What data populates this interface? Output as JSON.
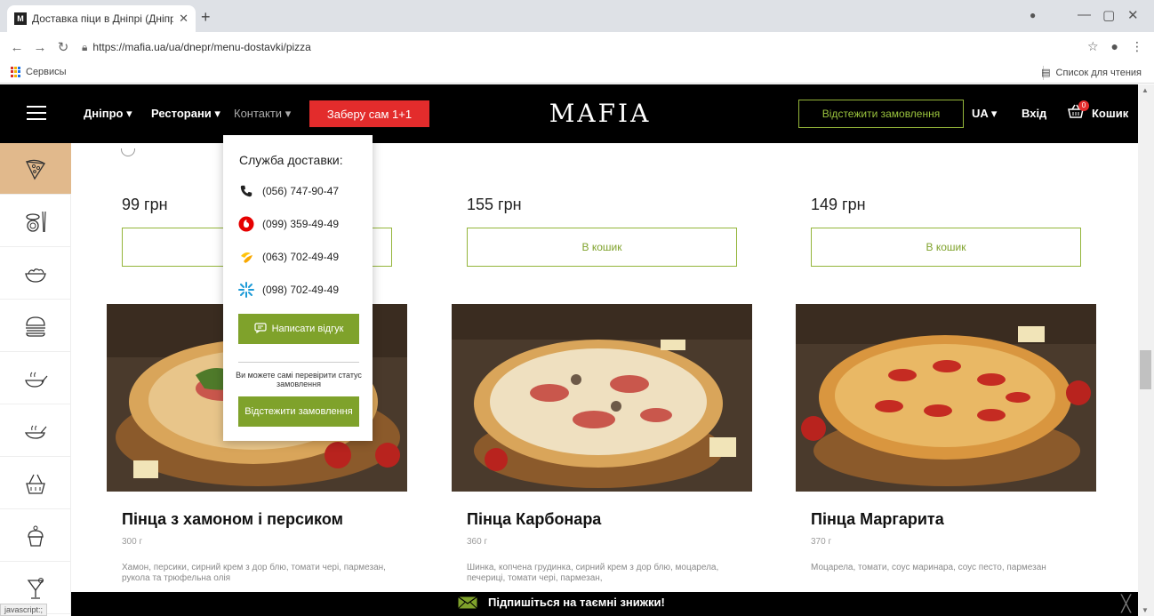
{
  "browser": {
    "tab_title": "Доставка піци в Дніпрі (Дніпро",
    "tab_favicon": "M",
    "url": "https://mafia.ua/ua/dnepr/menu-dostavki/pizza",
    "bookmark_apps": "Сервисы",
    "reading_list": "Список для чтения"
  },
  "header": {
    "city": "Дніпро",
    "restaurants": "Ресторани",
    "contacts": "Контакти",
    "promo": "Заберу сам 1+1",
    "logo": "MAFIA",
    "track": "Відстежити замовлення",
    "lang": "UA",
    "login": "Вхід",
    "cart": "Кошик",
    "cart_count": "0"
  },
  "sidebar": {
    "categories": [
      "pizza",
      "sushi",
      "salads",
      "burgers",
      "hot-dishes",
      "soups",
      "sets",
      "desserts",
      "drinks"
    ]
  },
  "contacts_menu": {
    "title": "Служба доставки:",
    "phones": [
      {
        "operator": "landline",
        "number": "(056) 747-90-47"
      },
      {
        "operator": "vodafone",
        "number": "(099) 359-49-49"
      },
      {
        "operator": "lifecell",
        "number": "(063) 702-49-49"
      },
      {
        "operator": "kyivstar",
        "number": "(098) 702-49-49"
      }
    ],
    "feedback": "Написати відгук",
    "note": "Ви можете самі перевірити статус замовлення",
    "track": "Відстежити замовлення"
  },
  "products_top": [
    {
      "price": "99 грн",
      "button": "В кошик"
    },
    {
      "price": "155 грн",
      "button": "В кошик"
    },
    {
      "price": "149 грн",
      "button": "В кошик"
    }
  ],
  "products": [
    {
      "name": "Пінца з хамоном і персиком",
      "weight": "300 г",
      "desc": "Хамон, персики, сирний крем з дор блю, томати чері, пармезан, рукола та трюфельна олія"
    },
    {
      "name": "Пінца Карбонара",
      "weight": "360 г",
      "desc": "Шинка, копчена грудинка, сирний крем з дор блю, моцарела, печериці, томати чері, пармезан,"
    },
    {
      "name": "Пінца Маргарита",
      "weight": "370 г",
      "desc": "Моцарела, томати, соус маринара, соус песто, пармезан"
    }
  ],
  "subscribe": {
    "text": "Підпишіться на таємні знижки!"
  },
  "status_bar": "javascript:;",
  "colors": {
    "accent_green": "#7fa22b",
    "promo_red": "#e32c2c",
    "active_category": "#e1b98c",
    "header_bg": "#000000"
  }
}
